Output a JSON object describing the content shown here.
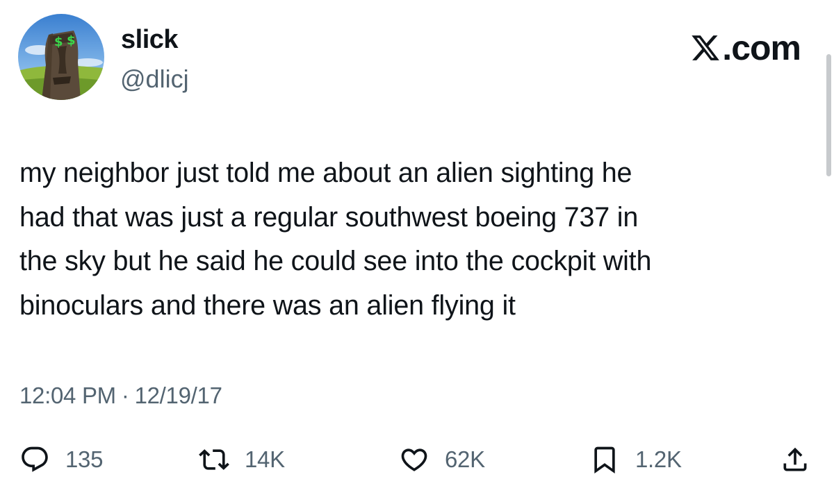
{
  "author": {
    "display_name": "slick",
    "handle": "@dlicj",
    "avatar": "moai-statue-with-green-eyes"
  },
  "brand": {
    "logo": "x-logo-icon",
    "domain_suffix": ".com"
  },
  "tweet": {
    "text_lines": [
      "my neighbor just told me about an alien sighting he",
      "had that was just a regular southwest boeing 737 in",
      "the sky but he said he could see into the cockpit with",
      "binoculars and there was an alien flying it"
    ],
    "time": "12:04 PM",
    "separator": "·",
    "date": "12/19/17"
  },
  "actions": {
    "reply": {
      "icon": "reply-icon",
      "count": "135"
    },
    "retweet": {
      "icon": "retweet-icon",
      "count": "14K"
    },
    "like": {
      "icon": "heart-icon",
      "count": "62K"
    },
    "bookmark": {
      "icon": "bookmark-icon",
      "count": "1.2K"
    },
    "share": {
      "icon": "share-icon"
    }
  },
  "colors": {
    "text_primary": "#0f1419",
    "text_secondary": "#536471",
    "background": "#ffffff"
  }
}
